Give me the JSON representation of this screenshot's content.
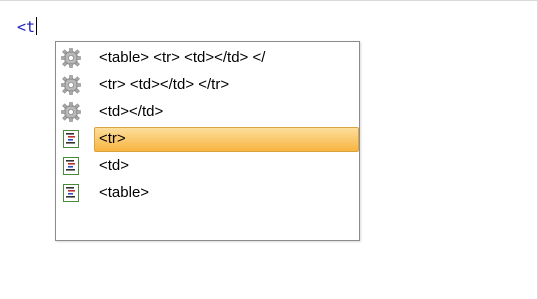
{
  "editor": {
    "typed_text": "<t"
  },
  "completion": {
    "items": [
      {
        "label": "<table> <tr> <td></td> </",
        "icon": "snippet-gear-icon",
        "selected": false
      },
      {
        "label": "<tr> <td></td> </tr>",
        "icon": "snippet-gear-icon",
        "selected": false
      },
      {
        "label": "<td></td>",
        "icon": "snippet-gear-icon",
        "selected": false
      },
      {
        "label": "<tr>",
        "icon": "tag-document-icon",
        "selected": true
      },
      {
        "label": "<td>",
        "icon": "tag-document-icon",
        "selected": false
      },
      {
        "label": "<table>",
        "icon": "tag-document-icon",
        "selected": false
      }
    ]
  },
  "colors": {
    "code_text": "#1f1fbf",
    "selection_top": "#fdde9c",
    "selection_bottom": "#f8b440",
    "selection_border": "#d8a440"
  }
}
